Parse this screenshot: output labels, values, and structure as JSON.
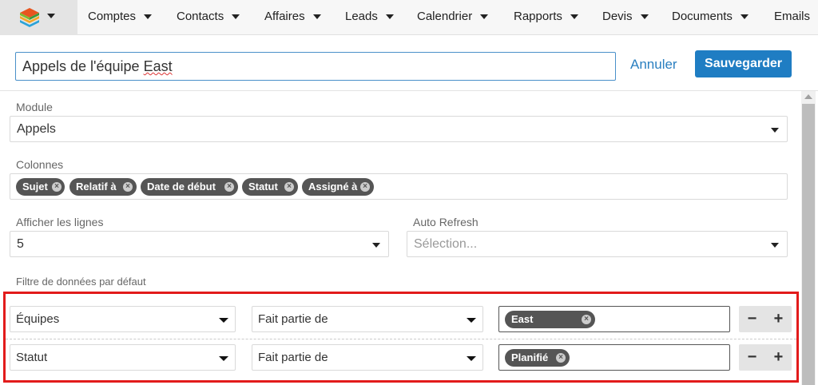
{
  "nav": {
    "items": [
      "Comptes",
      "Contacts",
      "Affaires",
      "Leads",
      "Calendrier",
      "Rapports",
      "Devis",
      "Documents",
      "Emails"
    ]
  },
  "title": {
    "value_prefix": "Appels de l'équipe ",
    "value_misspelled": "East"
  },
  "actions": {
    "cancel": "Annuler",
    "save": "Sauvegarder"
  },
  "module": {
    "label": "Module",
    "value": "Appels"
  },
  "columns": {
    "label": "Colonnes",
    "tags": [
      "Sujet",
      "Relatif à",
      "Date de début",
      "Statut",
      "Assigné à"
    ]
  },
  "rows": {
    "label": "Afficher les lignes",
    "value": "5"
  },
  "refresh": {
    "label": "Auto Refresh",
    "placeholder": "Sélection..."
  },
  "filter": {
    "label": "Filtre de données par défaut",
    "rows": [
      {
        "field": "Équipes",
        "operator": "Fait partie de",
        "value": "East",
        "minus": "−",
        "plus": "+"
      },
      {
        "field": "Statut",
        "operator": "Fait partie de",
        "value": "Planifié",
        "minus": "−",
        "plus": "+"
      }
    ]
  },
  "colors": {
    "accent": "#1f7dc3",
    "link": "#2a7fc0",
    "highlight": "#e21b1b",
    "tag": "#555555"
  },
  "icons": {
    "remove": "×"
  }
}
